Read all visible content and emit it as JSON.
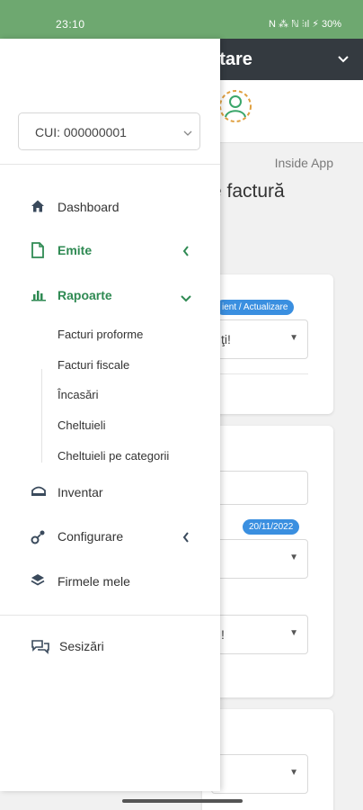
{
  "status_bar": {
    "time": "23:10",
    "indicators": "N ⁂ ℕ  ⫶ıl ⚡ 30%",
    "battery": "30%"
  },
  "background_app": {
    "title": "ntare",
    "breadcrumb": "Inside App",
    "heading": "e factură",
    "pill_client": "ient / Actualizare",
    "pill_date": "20/11/2022",
    "select_partial_1": "ţi!",
    "select_partial_2": "!"
  },
  "drawer": {
    "company_select": {
      "value": "CUI: 000000001"
    },
    "nav": [
      {
        "label": "Dashboard",
        "icon": "home-icon"
      },
      {
        "label": "Emite",
        "icon": "document-icon",
        "active": true,
        "expanded": false
      },
      {
        "label": "Rapoarte",
        "icon": "bar-chart-icon",
        "active": true,
        "expanded": true
      },
      {
        "label": "Inventar",
        "icon": "inventory-icon"
      },
      {
        "label": "Configurare",
        "icon": "config-icon",
        "expanded": false
      },
      {
        "label": "Firmele mele",
        "icon": "layers-icon"
      },
      {
        "label": "Sesizări",
        "icon": "chat-icon"
      }
    ],
    "rapoarte_sub": [
      "Facturi proforme",
      "Facturi fiscale",
      "Încasări",
      "Cheltuieli",
      "Cheltuieli pe categorii"
    ]
  },
  "colors": {
    "status_bar": "#6ea870",
    "active_green": "#2f8a53",
    "topbar_dark": "#343a40",
    "pill_blue": "#3a8fe0"
  }
}
